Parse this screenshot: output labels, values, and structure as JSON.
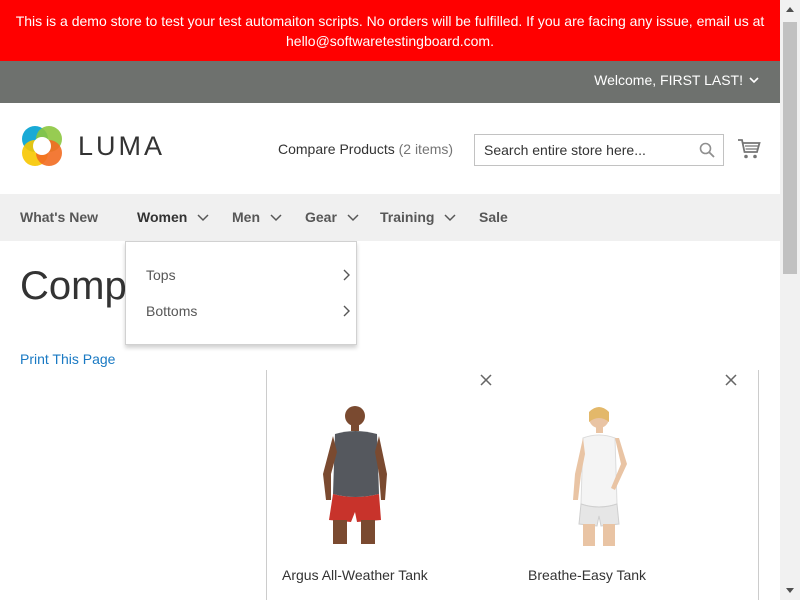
{
  "demo_notice": {
    "line1": "This is a demo store to test your test automaiton scripts. No orders will be fulfilled. If you are facing any issue, email us at",
    "line2": "hello@softwaretestingboard.com."
  },
  "header": {
    "welcome": "Welcome, FIRST LAST!",
    "logo_text": "LUMA",
    "compare_label": "Compare Products",
    "compare_count": "(2 items)",
    "search_placeholder": "Search entire store here...",
    "search_icon": "search-icon",
    "cart_icon": "cart-icon"
  },
  "nav": {
    "items": [
      {
        "label": "What's New",
        "has_dropdown": false
      },
      {
        "label": "Women",
        "has_dropdown": true
      },
      {
        "label": "Men",
        "has_dropdown": true
      },
      {
        "label": "Gear",
        "has_dropdown": true
      },
      {
        "label": "Training",
        "has_dropdown": true
      },
      {
        "label": "Sale",
        "has_dropdown": false
      }
    ]
  },
  "dropdown": {
    "items": [
      {
        "label": "Tops"
      },
      {
        "label": "Bottoms"
      }
    ]
  },
  "main": {
    "title": "Compare Products",
    "print_link": "Print This Page"
  },
  "products": [
    {
      "name": "Argus All-Weather Tank",
      "shirt_color": "#55585e",
      "shorts_color": "#c8332b"
    },
    {
      "name": "Breathe-Easy Tank",
      "shirt_color": "#f4f4f4",
      "shorts_color": "#e6e6e6"
    }
  ],
  "colors": {
    "demo_bar": "#ff0000",
    "welcome_bar": "#6e716e",
    "nav_bg": "#f0f0f0",
    "link": "#1979c3"
  }
}
